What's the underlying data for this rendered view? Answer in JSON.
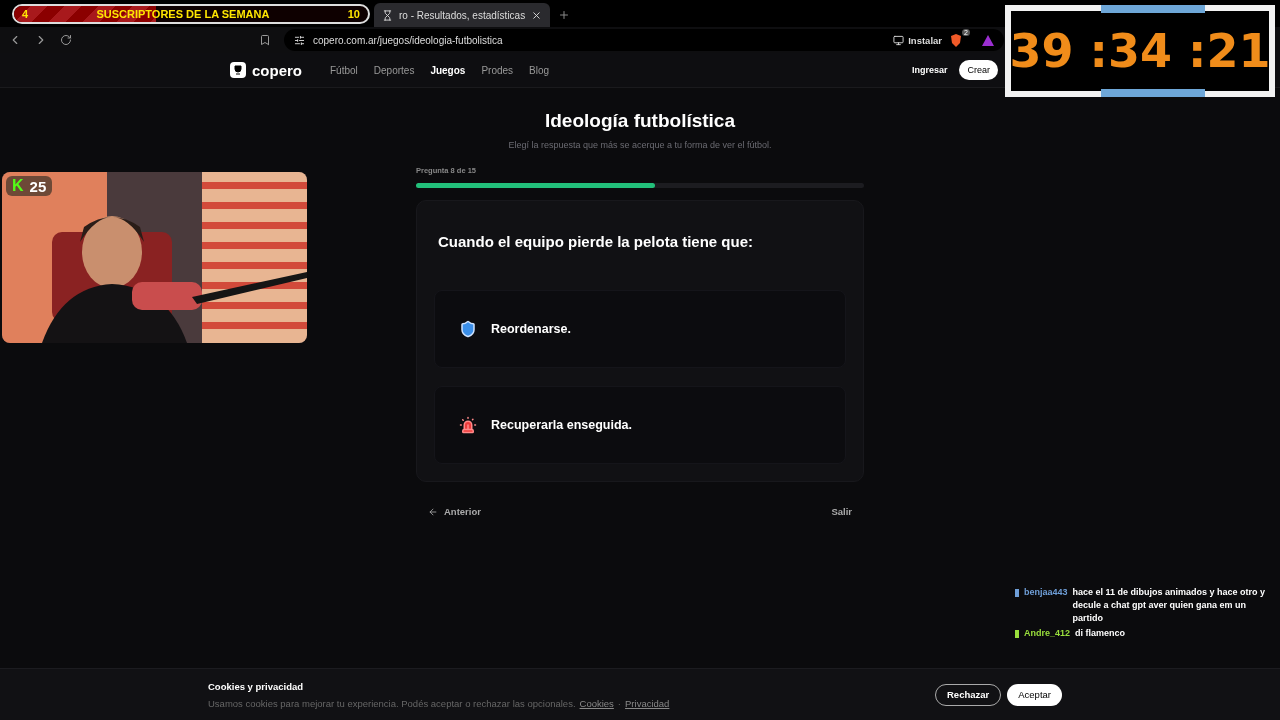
{
  "browser": {
    "tabs": [
      {
        "title": "ro - Resultados, estadísticas",
        "selected": true
      }
    ],
    "url": "copero.com.ar/juegos/ideologia-futbolistica",
    "install": "Instalar",
    "shield_count": "2"
  },
  "site": {
    "logo": "copero",
    "nav": [
      {
        "label": "Fútbol",
        "selected": false
      },
      {
        "label": "Deportes",
        "selected": false
      },
      {
        "label": "Juegos",
        "selected": true
      },
      {
        "label": "Prodes",
        "selected": false
      },
      {
        "label": "Blog",
        "selected": false
      }
    ],
    "login": "Ingresar",
    "signup": "Crear"
  },
  "quiz": {
    "title": "Ideología futbolística",
    "subtitle": "Elegí la respuesta que más se acerque a tu forma de ver el fútbol.",
    "progress_label": "Pregunta 8 de 15",
    "level": 0.533,
    "question": "Cuando el equipo pierde la pelota tiene que:",
    "options": [
      {
        "kind": "shield",
        "text": "Reordenarse."
      },
      {
        "kind": "siren",
        "text": "Recuperarla enseguida."
      }
    ],
    "back": "Anterior",
    "exit": "Salir"
  },
  "cookies": {
    "title": "Cookies y privacidad",
    "text": "Usamos cookies para mejorar tu experiencia. Podés aceptar o rechazar las opcionales.",
    "links": [
      "Cookies",
      "Privacidad"
    ],
    "link_separator": "·",
    "reject": "Rechazar",
    "accept": "Aceptar"
  },
  "stream": {
    "sub_goal": {
      "current": "4",
      "label": "SUSCRIPTORES DE LA SEMANA",
      "target": "10",
      "level": 0.4
    },
    "webcam": {
      "kind": "picture",
      "logo": "K",
      "viewers": "25"
    },
    "timer": "39 :34 :21",
    "chat": [
      {
        "user": "benjaa443",
        "color": "#6f9fd8",
        "text": "hace el 11 de dibujos animados y hace otro y decule a chat gpt aver quien gana em un partido"
      },
      {
        "user": "Andre_412",
        "color": "#9adf3c",
        "text": "di flamenco"
      }
    ]
  }
}
